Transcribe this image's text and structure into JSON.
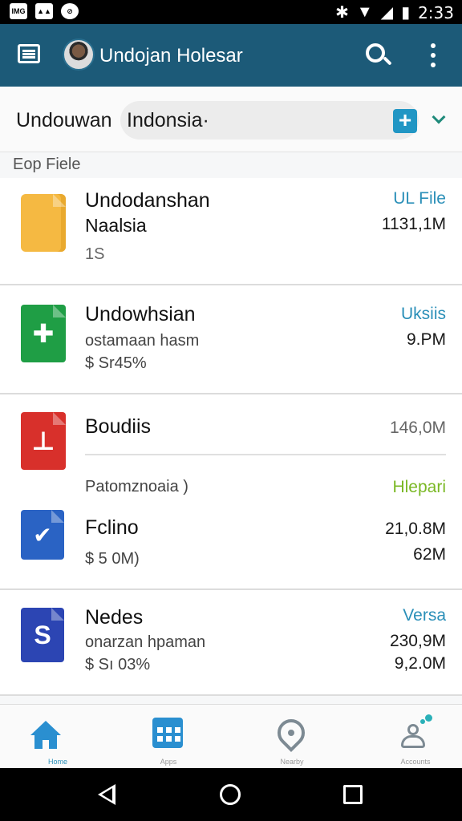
{
  "status_bar": {
    "left_icons": [
      "image-icon",
      "gallery-icon",
      "compass-icon"
    ],
    "left_texts": [
      "IMG",
      "▲▲",
      "⊘"
    ],
    "right_icons": [
      "bluetooth-icon",
      "wifi-icon",
      "signal-icon",
      "battery-icon"
    ],
    "time": "2:33"
  },
  "app_bar": {
    "title": "Undojan Holesar",
    "bg_color": "#1c5a78"
  },
  "search_row": {
    "scope_label": "Undouwan",
    "query": "Indonsia·",
    "add_label": "+"
  },
  "section": {
    "title": "Eop Fiele"
  },
  "files": [
    {
      "name": "Undodanshan",
      "sub1": "Naalsia",
      "sub2": "1S",
      "right1": "UL File",
      "right2": "1131,1M",
      "icon": "folder-icon"
    },
    {
      "name": "Undowhsian",
      "sub1": "ostamaan hasm",
      "sub2": "$ Sr45%",
      "right1": "Uksiis",
      "right2": "9.PM",
      "icon": "spreadsheet-icon"
    },
    {
      "name": "Boudiis",
      "sub1": "Patomznoaia )",
      "right1": "146,0M",
      "right2": "Hlepari",
      "icon": "pdf-icon"
    },
    {
      "name": "Fclino",
      "sub1": "$ 5 0M)",
      "right1": "21,0.8M",
      "right2": "62M",
      "icon": "document-icon"
    },
    {
      "name": "Nedes",
      "sub1": "onarzan hpaman",
      "sub2": "$ Sı 03%",
      "right1": "Versa",
      "right2": "230,9M",
      "right3": "9,2.0M",
      "icon": "slides-icon"
    }
  ],
  "bottom_nav": [
    {
      "label": "Home",
      "icon": "home-icon",
      "active": true
    },
    {
      "label": "Apps",
      "icon": "grid-icon",
      "active": false
    },
    {
      "label": "Nearby",
      "icon": "location-pin-icon",
      "active": false
    },
    {
      "label": "Accounts",
      "icon": "people-icon",
      "active": false
    }
  ],
  "colors": {
    "accent": "#2a8fb8",
    "green": "#7ab824",
    "appbar": "#1c5a78"
  }
}
